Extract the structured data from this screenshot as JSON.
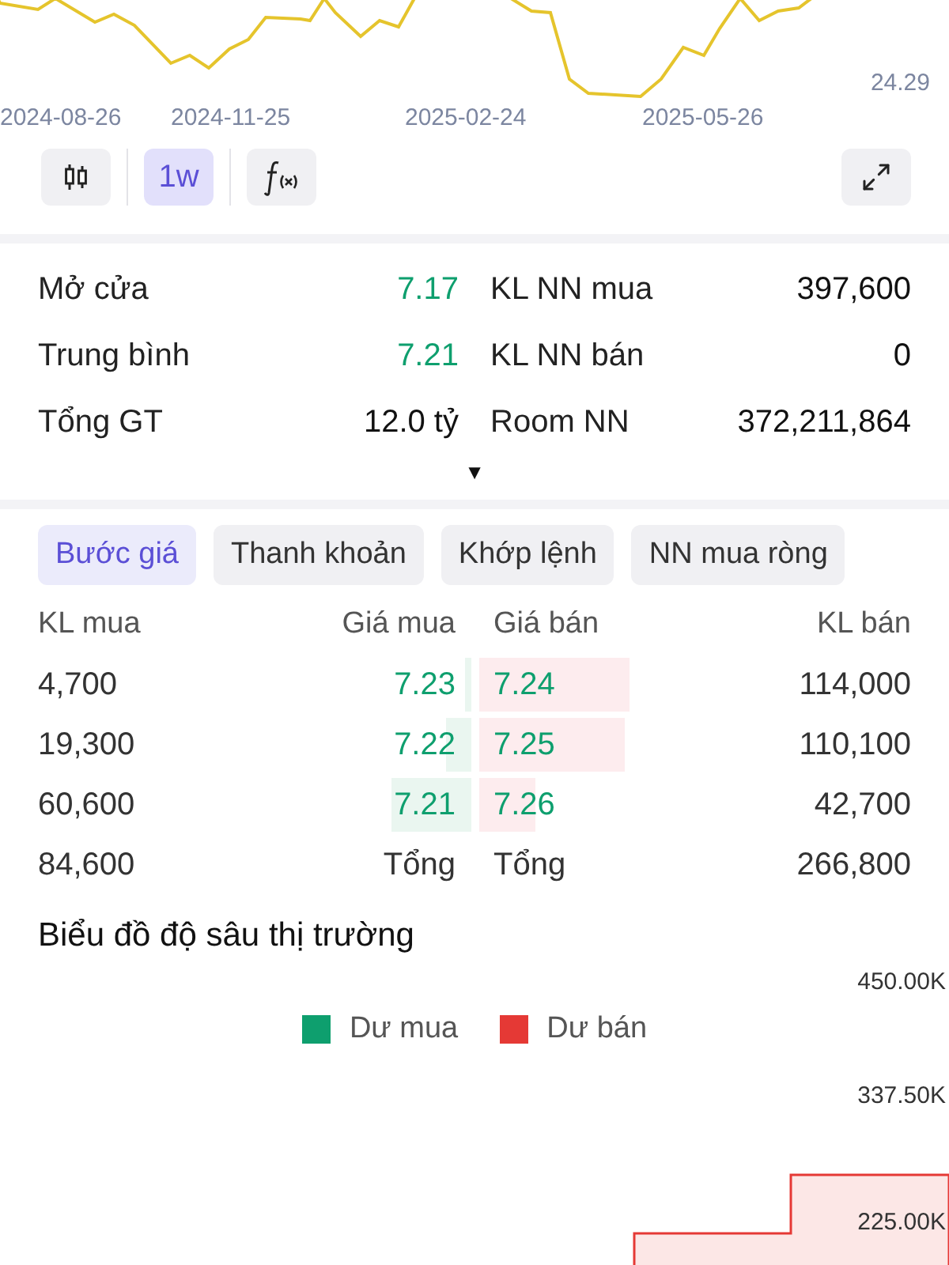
{
  "price_chart": {
    "x_labels": [
      "2024-08-26",
      "2024-11-25",
      "2025-02-24",
      "2025-05-26"
    ],
    "last_value": "24.29"
  },
  "toolbar": {
    "buttons": [
      {
        "kind": "candles",
        "selected": false
      },
      {
        "kind": "text",
        "label": "1w",
        "selected": true
      },
      {
        "kind": "formula",
        "selected": false
      }
    ]
  },
  "stats": [
    {
      "label": "Mở cửa",
      "value": "7.17",
      "color": "#0e9f6e"
    },
    {
      "label": "KL NN mua",
      "value": "397,600",
      "color": "#111111"
    },
    {
      "label": "Trung bình",
      "value": "7.21",
      "color": "#0e9f6e"
    },
    {
      "label": "KL NN bán",
      "value": "0",
      "color": "#111111"
    },
    {
      "label": "Tổng GT",
      "value": "12.0 tỷ",
      "color": "#111111"
    },
    {
      "label": "Room NN",
      "value": "372,211,864",
      "color": "#111111"
    }
  ],
  "collapse_toggle": "▼",
  "tabs": [
    {
      "label": "Bước giá",
      "selected": true
    },
    {
      "label": "Thanh khoản",
      "selected": false
    },
    {
      "label": "Khớp lệnh",
      "selected": false
    },
    {
      "label": "NN mua ròng",
      "selected": false
    }
  ],
  "order_book": {
    "columns": [
      "KL mua",
      "Giá mua",
      "Giá bán",
      "KL bán"
    ],
    "rows": [
      {
        "buy": {
          "volume": "4,700",
          "price": "7.23"
        },
        "sell": {
          "price": "7.24",
          "volume": "114,000"
        }
      },
      {
        "buy": {
          "volume": "19,300",
          "price": "7.22"
        },
        "sell": {
          "price": "7.25",
          "volume": "110,100"
        }
      },
      {
        "buy": {
          "volume": "60,600",
          "price": "7.21"
        },
        "sell": {
          "price": "7.26",
          "volume": "42,700"
        }
      }
    ],
    "total": {
      "buy_volume": "84,600",
      "buy_label": "Tổng",
      "sell_label": "Tổng",
      "sell_volume": "266,800"
    }
  },
  "depth_chart": {
    "title": "Biểu đồ độ sâu thị trường",
    "y_labels": [
      "450.00K",
      "337.50K",
      "225.00K"
    ],
    "legend": [
      {
        "label": "Dư mua",
        "color": "#0e9f6e"
      },
      {
        "label": "Dư bán",
        "color": "#e53935"
      }
    ]
  }
}
